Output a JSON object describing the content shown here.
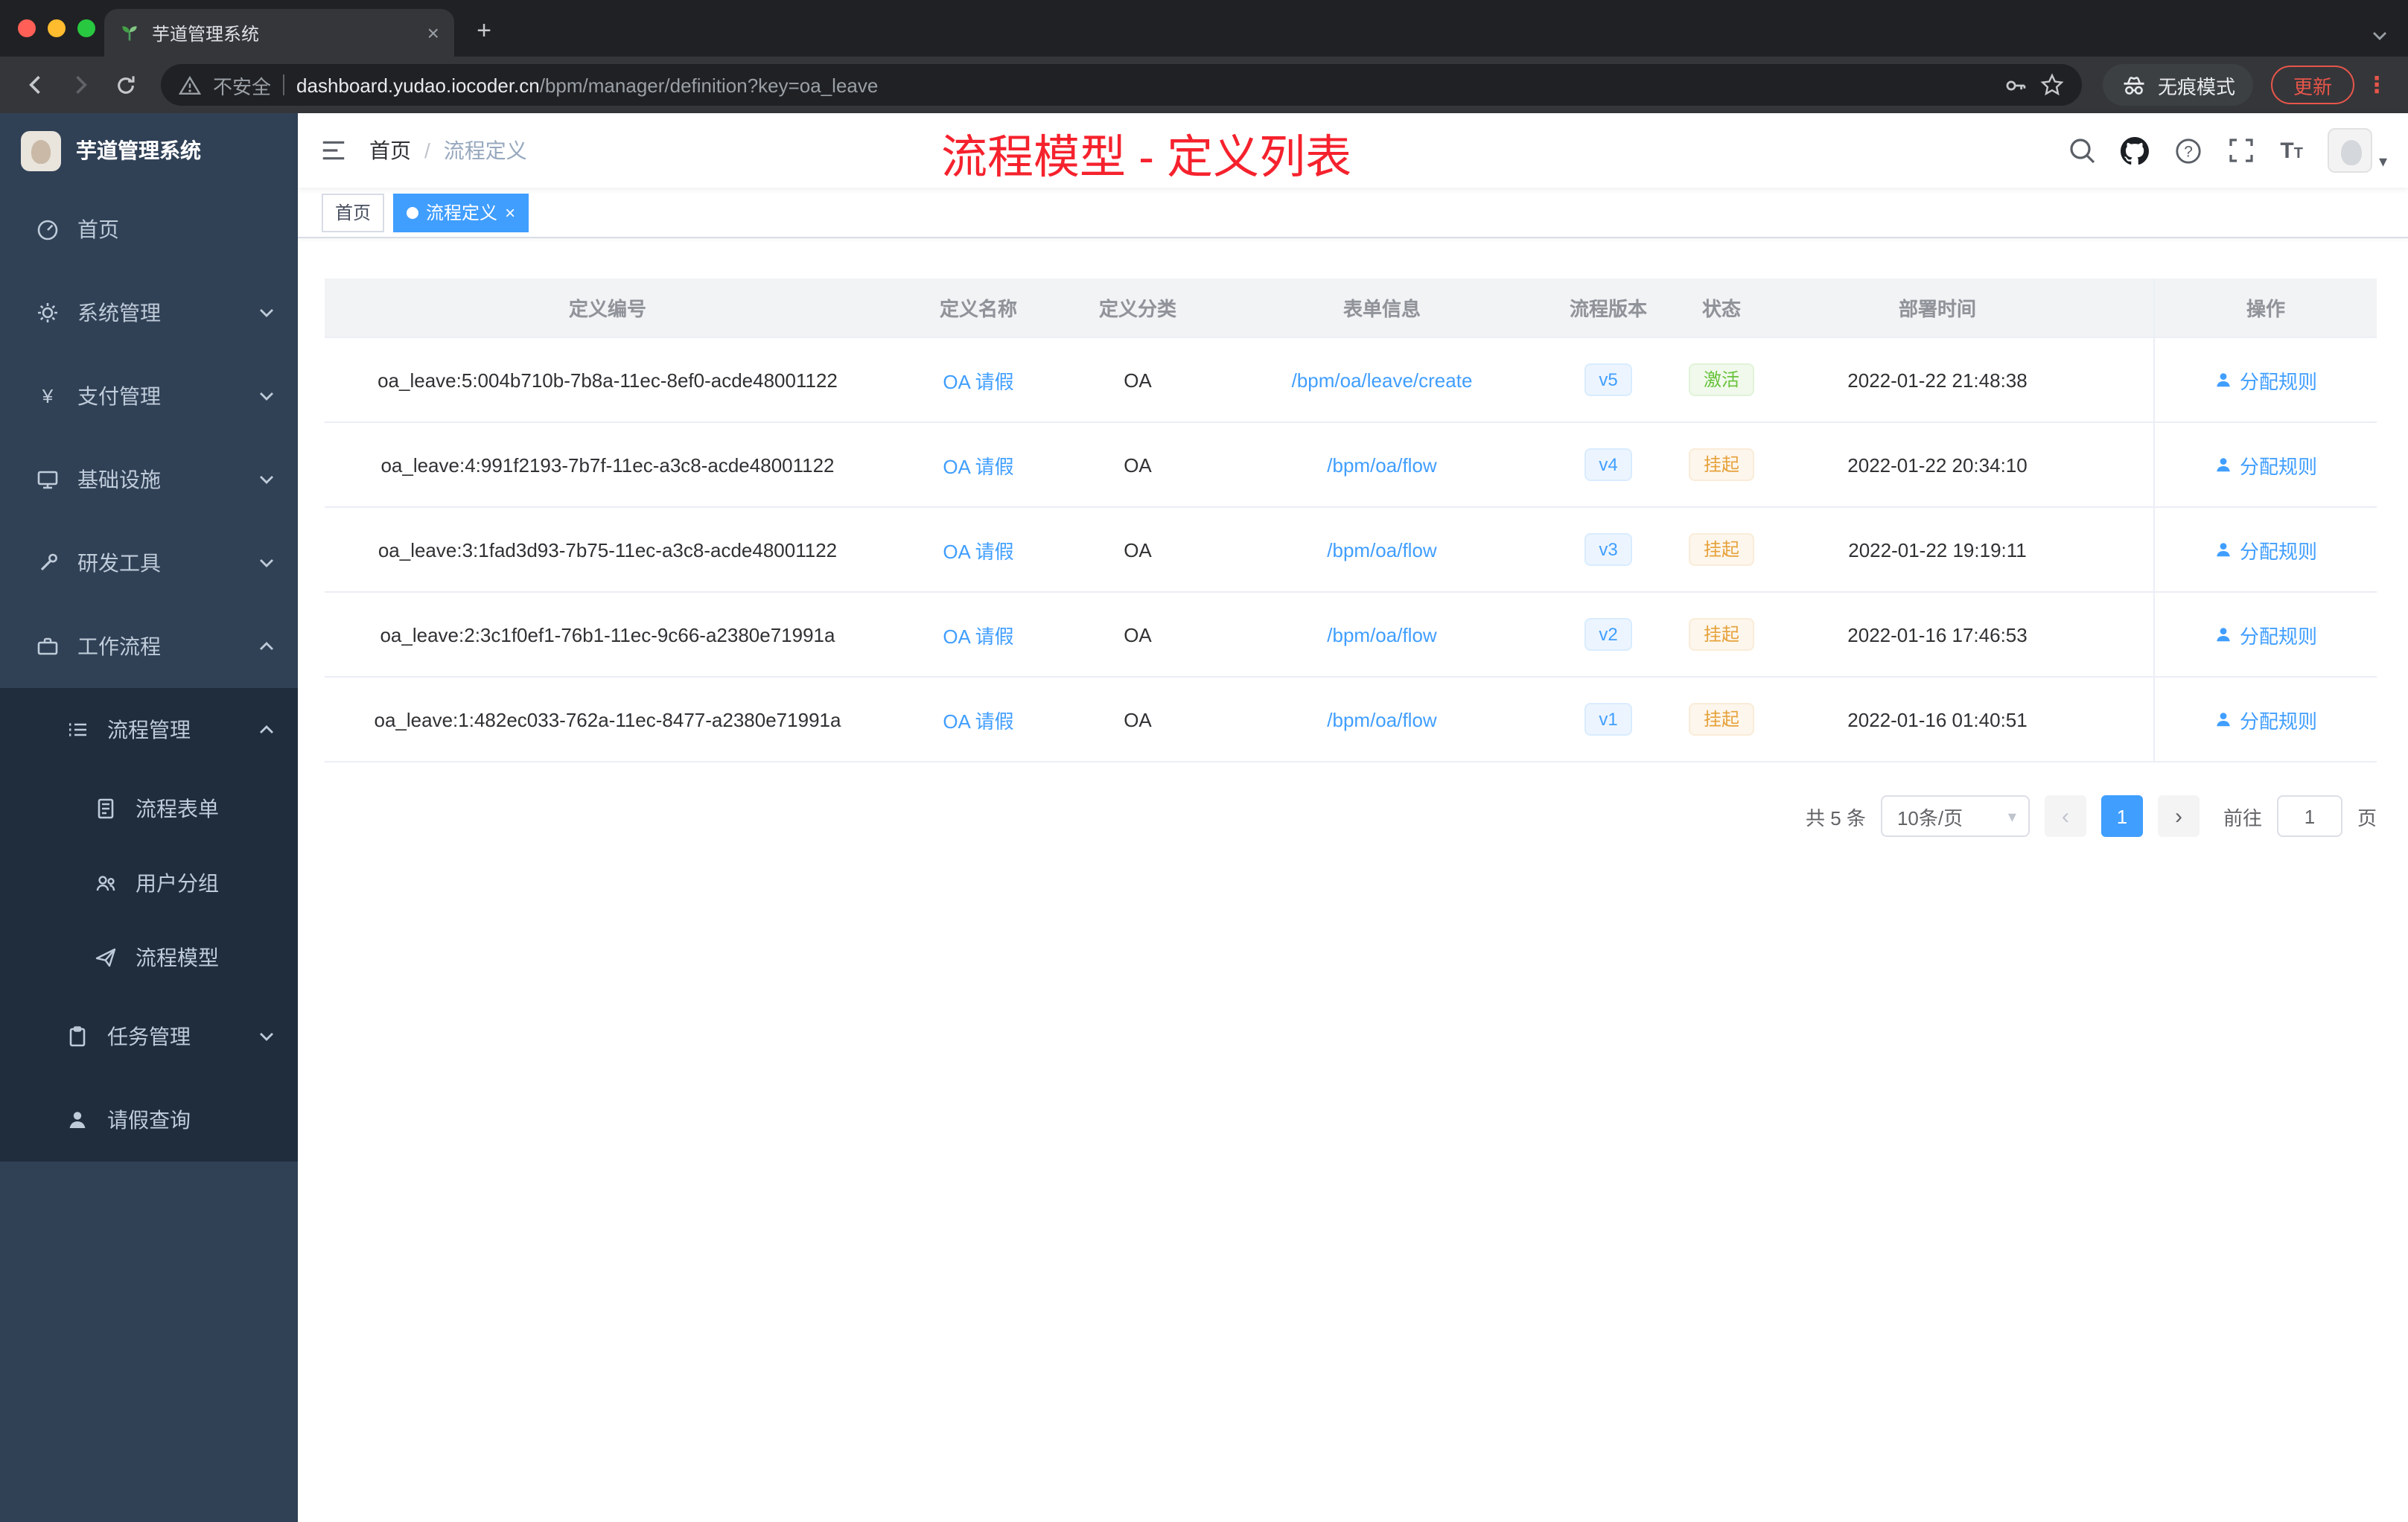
{
  "browser": {
    "tab_title": "芋道管理系统",
    "security_label": "不安全",
    "url_host": "dashboard.yudao.iocoder.cn",
    "url_path": "/bpm/manager/definition?key=oa_leave",
    "incognito_label": "无痕模式",
    "update_label": "更新"
  },
  "glyphs": {
    "yen": "¥",
    "close": "×",
    "plus": "+",
    "dots": "⋮",
    "caret_down": "▾",
    "question": "?",
    "t_large": "T",
    "t_small": "T"
  },
  "sidebar": {
    "logo_title": "芋道管理系统",
    "items": [
      {
        "label": "首页",
        "icon": "dashboard-icon"
      },
      {
        "label": "系统管理",
        "icon": "gear-icon"
      },
      {
        "label": "支付管理",
        "icon": "yen-icon"
      },
      {
        "label": "基础设施",
        "icon": "monitor-icon"
      },
      {
        "label": "研发工具",
        "icon": "tool-icon"
      },
      {
        "label": "工作流程",
        "icon": "briefcase-icon"
      },
      {
        "label": "流程管理",
        "icon": "list-icon"
      },
      {
        "label": "流程表单",
        "icon": "form-icon"
      },
      {
        "label": "用户分组",
        "icon": "people-icon"
      },
      {
        "label": "流程模型",
        "icon": "send-icon"
      },
      {
        "label": "任务管理",
        "icon": "clipboard-icon"
      },
      {
        "label": "请假查询",
        "icon": "user-icon"
      }
    ]
  },
  "header": {
    "breadcrumb_home": "首页",
    "breadcrumb_separator": "/",
    "breadcrumb_current": "流程定义",
    "annotation": "流程模型 - 定义列表"
  },
  "tags": {
    "home": "首页",
    "active": "流程定义"
  },
  "table": {
    "columns": [
      "定义编号",
      "定义名称",
      "定义分类",
      "表单信息",
      "流程版本",
      "状态",
      "部署时间",
      "操作"
    ],
    "rows": [
      {
        "id": "oa_leave:5:004b710b-7b8a-11ec-8ef0-acde48001122",
        "name": "OA 请假",
        "category": "OA",
        "form": "/bpm/oa/leave/create",
        "version": "v5",
        "status": "激活",
        "time": "2022-01-22 21:48:38",
        "action": "分配规则"
      },
      {
        "id": "oa_leave:4:991f2193-7b7f-11ec-a3c8-acde48001122",
        "name": "OA 请假",
        "category": "OA",
        "form": "/bpm/oa/flow",
        "version": "v4",
        "status": "挂起",
        "time": "2022-01-22 20:34:10",
        "action": "分配规则"
      },
      {
        "id": "oa_leave:3:1fad3d93-7b75-11ec-a3c8-acde48001122",
        "name": "OA 请假",
        "category": "OA",
        "form": "/bpm/oa/flow",
        "version": "v3",
        "status": "挂起",
        "time": "2022-01-22 19:19:11",
        "action": "分配规则"
      },
      {
        "id": "oa_leave:2:3c1f0ef1-76b1-11ec-9c66-a2380e71991a",
        "name": "OA 请假",
        "category": "OA",
        "form": "/bpm/oa/flow",
        "version": "v2",
        "status": "挂起",
        "time": "2022-01-16 17:46:53",
        "action": "分配规则"
      },
      {
        "id": "oa_leave:1:482ec033-762a-11ec-8477-a2380e71991a",
        "name": "OA 请假",
        "category": "OA",
        "form": "/bpm/oa/flow",
        "version": "v1",
        "status": "挂起",
        "time": "2022-01-16 01:40:51",
        "action": "分配规则"
      }
    ]
  },
  "pagination": {
    "total": "共 5 条",
    "page_size": "10条/页",
    "prev": "‹",
    "page": "1",
    "next": "›",
    "goto_label": "前往",
    "goto_value": "1",
    "goto_unit": "页"
  },
  "colors": {
    "accent": "#409eff",
    "success": "#67c23a",
    "warning": "#e6a23c",
    "annotation_red": "#f5222d",
    "sidebar_bg": "#304156",
    "sidebar_submenu_bg": "#1f2d3d",
    "tag_active_bg": "#409eff"
  }
}
